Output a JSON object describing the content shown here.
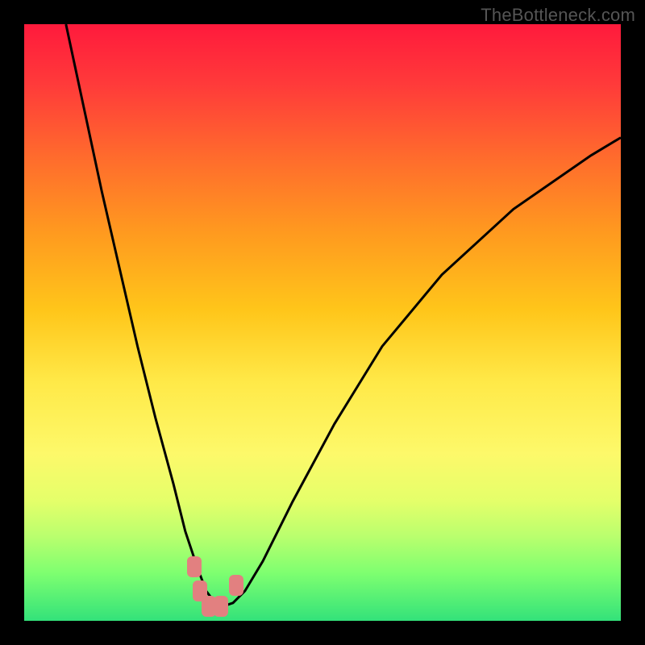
{
  "watermark": "TheBottleneck.com",
  "chart_data": {
    "type": "line",
    "title": "",
    "xlabel": "",
    "ylabel": "",
    "xlim": [
      0,
      100
    ],
    "ylim": [
      0,
      100
    ],
    "series": [
      {
        "name": "bottleneck-curve",
        "x": [
          7,
          10,
          13,
          16,
          19,
          22,
          25,
          27,
          29,
          30.5,
          32,
          33.5,
          35,
          37,
          40,
          45,
          52,
          60,
          70,
          82,
          95,
          100
        ],
        "values": [
          100,
          86,
          72,
          59,
          46,
          34,
          23,
          15,
          9,
          5,
          3,
          2.5,
          3,
          5,
          10,
          20,
          33,
          46,
          58,
          69,
          78,
          81
        ]
      }
    ],
    "markers": [
      {
        "name": "marker-left-top",
        "x": 28.5,
        "y": 9
      },
      {
        "name": "marker-left-mid",
        "x": 29.5,
        "y": 5
      },
      {
        "name": "marker-bottom-1",
        "x": 31,
        "y": 2.5
      },
      {
        "name": "marker-bottom-2",
        "x": 33,
        "y": 2.5
      },
      {
        "name": "marker-right",
        "x": 35.5,
        "y": 6
      }
    ],
    "colors": {
      "curve": "#000000",
      "marker": "#e28080",
      "gradient_top": "#ff1a3c",
      "gradient_bottom": "#33e27a"
    }
  }
}
